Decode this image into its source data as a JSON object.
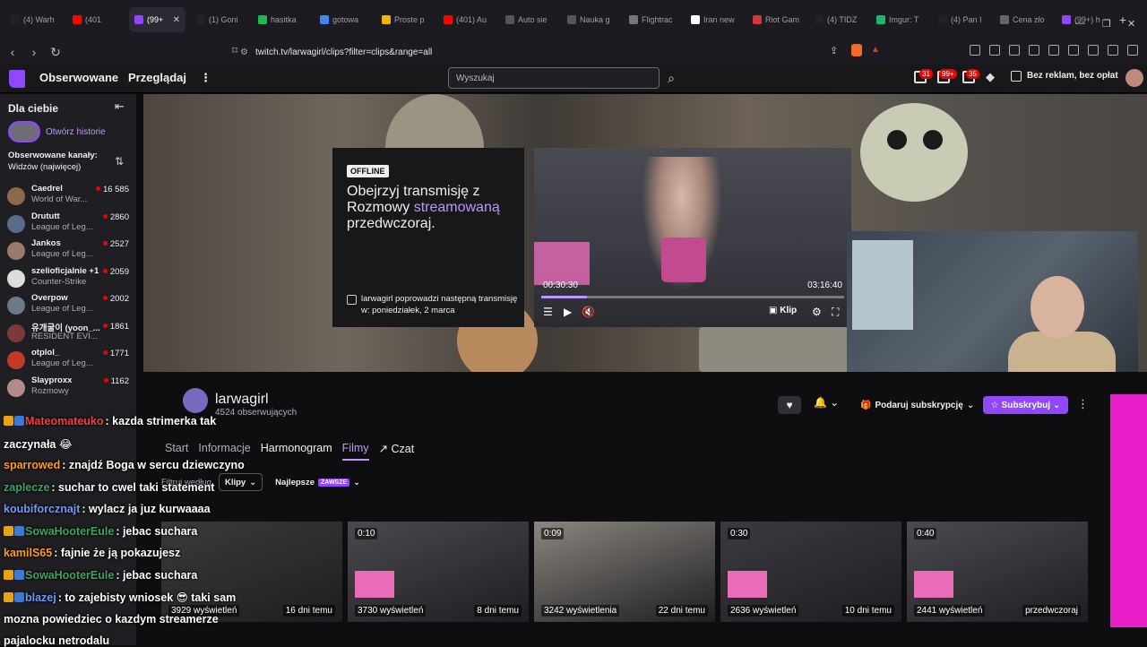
{
  "browser": {
    "tabs": [
      {
        "label": "(4) Warh",
        "fav": "#222",
        "icon": "x-icon"
      },
      {
        "label": "(401",
        "fav": "#ff0000",
        "icon": "youtube-icon"
      },
      {
        "label": "(99+",
        "fav": "#9147ff",
        "icon": "twitch-icon",
        "active": true
      },
      {
        "label": "(1) Goni",
        "fav": "#222",
        "icon": "x-icon"
      },
      {
        "label": "hasitka",
        "fav": "#1db954",
        "icon": "kick-icon"
      },
      {
        "label": "gotowa",
        "fav": "#4285f4",
        "icon": "google-icon"
      },
      {
        "label": "Proste p",
        "fav": "#f4b400",
        "icon": "map-pin-icon"
      },
      {
        "label": "(401) Au",
        "fav": "#ff0000",
        "icon": "youtube-icon"
      },
      {
        "label": "Auto sie",
        "fav": "#555",
        "icon": "page-icon"
      },
      {
        "label": "Nauka g",
        "fav": "#555",
        "icon": "map-pin-icon"
      },
      {
        "label": "Flightrac",
        "fav": "#777",
        "icon": "globe-icon"
      },
      {
        "label": "Iran new",
        "fav": "#fff",
        "icon": "news-icon"
      },
      {
        "label": "Riot Gam",
        "fav": "#d13639",
        "icon": "riot-icon"
      },
      {
        "label": "(4) TIDZ",
        "fav": "#222",
        "icon": "x-icon"
      },
      {
        "label": "Imgur: T",
        "fav": "#1bb76e",
        "icon": "imgur-icon"
      },
      {
        "label": "(4) Pan I",
        "fav": "#222",
        "icon": "x-icon"
      },
      {
        "label": "Cena zło",
        "fav": "#666",
        "icon": "page-icon"
      },
      {
        "label": "(99+) h",
        "fav": "#9147ff",
        "icon": "twitch-icon"
      }
    ],
    "url": "twitch.tv/larwagirl/clips?filter=clips&range=all"
  },
  "nav": {
    "following": "Obserwowane",
    "browse": "Przeglądaj",
    "search_placeholder": "Wyszukaj",
    "badges": [
      "31",
      "99+",
      "35"
    ],
    "ad_free": "Bez reklam, bez opłat"
  },
  "sidebar": {
    "title": "Dla ciebie",
    "story": "Otwórz historie",
    "followed_label": "Obserwowane kanały:",
    "followed_sort": "Widzów (najwięcej)",
    "channels": [
      {
        "name": "Caedrel",
        "game": "World of War...",
        "viewers": "16 585",
        "color": "#8b6a4a"
      },
      {
        "name": "Drututt",
        "game": "League of Leg...",
        "viewers": "2860",
        "color": "#5a6a8a"
      },
      {
        "name": "Jankos",
        "game": "League of Leg...",
        "viewers": "2527",
        "color": "#9a7a6a"
      },
      {
        "name": "szelioficjalnie +1",
        "game": "Counter-Strike",
        "viewers": "2059",
        "color": "#ddd"
      },
      {
        "name": "Overpow",
        "game": "League of Leg...",
        "viewers": "2002",
        "color": "#6a7a8a"
      },
      {
        "name": "유개굴이 (yoon_...",
        "game": "RESIDENT EVI...",
        "viewers": "1861",
        "color": "#7a3a3a"
      },
      {
        "name": "otplol_",
        "game": "League of Leg...",
        "viewers": "1771",
        "color": "#c0392b"
      },
      {
        "name": "Slayproxx",
        "game": "Rozmowy",
        "viewers": "1162",
        "color": "#b58a8a"
      }
    ]
  },
  "offline": {
    "badge": "OFFLINE",
    "line1": "Obejrzyj transmisję z",
    "line2a": "Rozmowy ",
    "line2b": "streamowaną",
    "line3": "przedwczoraj.",
    "next": "larwagirl poprowadzi następną transmisję w: poniedziałek, 2 marca"
  },
  "player": {
    "elapsed": "00:30:30",
    "total": "03:16:40",
    "clip": "Klip",
    "progress": 0.15
  },
  "channel": {
    "name": "larwagirl",
    "followers": "4524 obserwujących",
    "donate": "Podaruj subskrypcję",
    "subscribe": "Subskrybuj",
    "tabs": [
      "Start",
      "Informacje",
      "Harmonogram",
      "Filmy",
      "Czat"
    ],
    "active_tab": "Filmy",
    "filter_label": "Filtruj według",
    "filter_value": "Klipy",
    "sort_value": "Najlepsze",
    "sort_tag": "ZAWSZE"
  },
  "clips": [
    {
      "duration": "",
      "views": "3929 wyświetleń",
      "date": "16 dni temu",
      "bg": "#3b3a3a"
    },
    {
      "duration": "0:10",
      "views": "3730 wyświetleń",
      "date": "8 dni temu",
      "bg": "#4a4a4e"
    },
    {
      "duration": "0:09",
      "views": "3242 wyświetlenia",
      "date": "22 dni temu",
      "bg": "#8a857e"
    },
    {
      "duration": "0:30",
      "views": "2636 wyświetleń",
      "date": "10 dni temu",
      "bg": "#3a3a40"
    },
    {
      "duration": "0:40",
      "views": "2441 wyświetleń",
      "date": "przedwczoraj",
      "bg": "#4c4a50"
    }
  ],
  "chat": [
    {
      "nick": "Mateomateuko",
      "color": "#ff3b3b",
      "text": ": kazda strimerka tak",
      "icons": true
    },
    {
      "nick": "",
      "color": "#fff",
      "text": "zaczynała 😂",
      "icons": false
    },
    {
      "nick": "sparrowed",
      "color": "#ff9f1a",
      "text": ": znajdź Boga w sercu dziewczyno",
      "icons": false
    },
    {
      "nick": "zaplecze",
      "color": "#3ba55d",
      "text": ": suchar to cwel taki statement",
      "icons": false
    },
    {
      "nick": "koubiforcznajt",
      "color": "#6e9bff",
      "text": ": wylacz ja juz kurwaaaa",
      "icons": false
    },
    {
      "nick": "SowaHooterEule",
      "color": "#3ba55d",
      "text": ": jebac suchara",
      "icons": true
    },
    {
      "nick": "kamilS65",
      "color": "#ff9f1a",
      "text": ": fajnie że ją pokazujesz",
      "icons": false
    },
    {
      "nick": "SowaHooterEule",
      "color": "#3ba55d",
      "text": ": jebac suchara",
      "icons": true
    },
    {
      "nick": "blazej",
      "color": "#6e9bff",
      "text": ": to zajebisty wniosek 😎 taki sam",
      "icons": true
    },
    {
      "nick": "",
      "color": "#fff",
      "text": "mozna powiedziec o kazdym streamerze",
      "icons": false
    },
    {
      "nick": "",
      "color": "#fff",
      "text": "pajalocku netrodalu",
      "icons": false
    }
  ]
}
